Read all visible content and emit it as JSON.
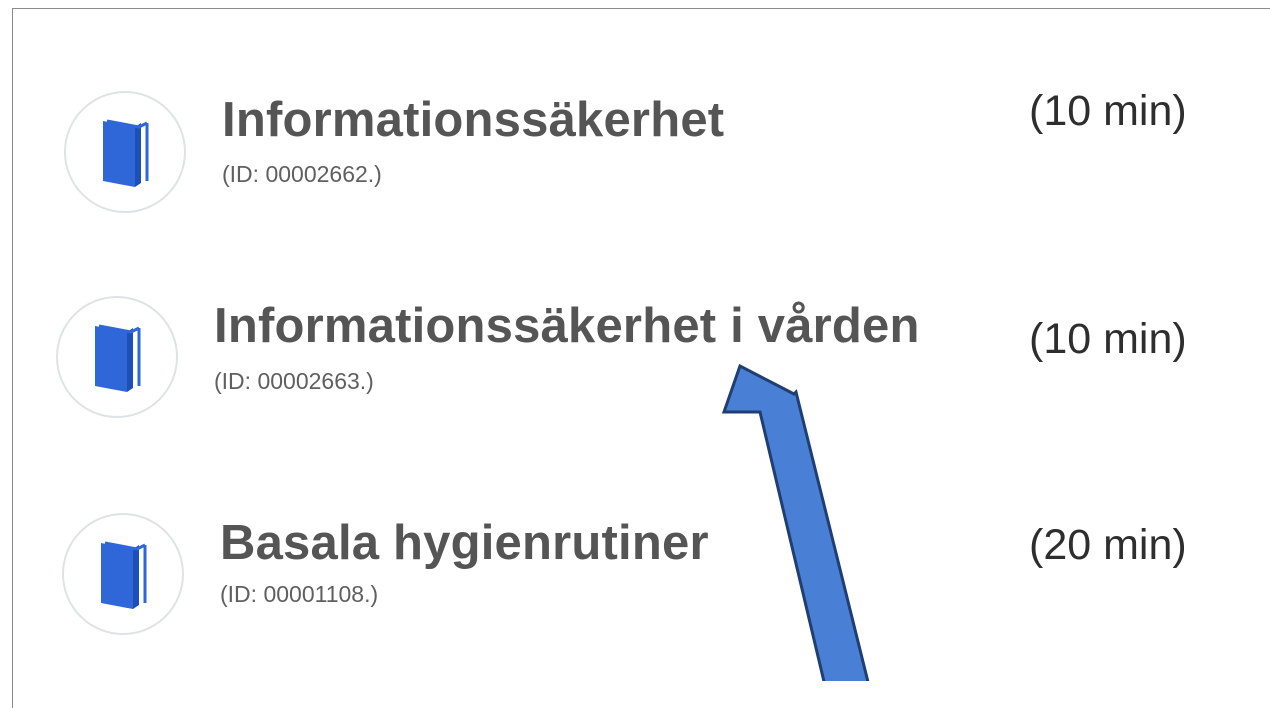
{
  "courses": [
    {
      "title": "Informationssäkerhet",
      "id": "(ID: 00002662.)",
      "duration": "(10 min)",
      "icon": "book-icon"
    },
    {
      "title": "Informationssäkerhet i vården",
      "id": "(ID: 00002663.)",
      "duration": "(10 min)",
      "icon": "book-icon"
    },
    {
      "title": "Basala hygienrutiner",
      "id": "(ID: 00001108.)",
      "duration": "(20 min)",
      "icon": "book-icon"
    }
  ],
  "colors": {
    "book_front": "#2f67d8",
    "book_edge": "#3f79ea",
    "arrow_fill": "#4a7fd6",
    "arrow_stroke": "#1f3f73"
  }
}
